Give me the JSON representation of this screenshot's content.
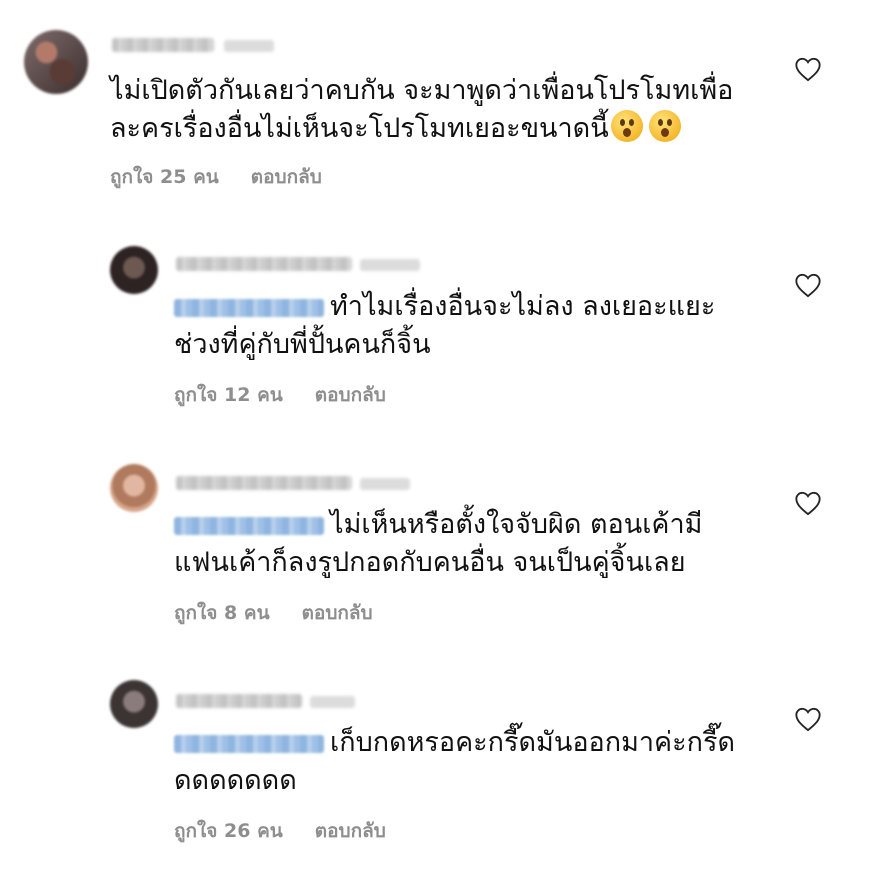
{
  "comments": [
    {
      "text_line1": "ไม่เปิดตัวกันเลยว่าคบกัน จะมาพูดว่าเพื่อนโปรโมทเพื่อ",
      "text_line2": "ละครเรื่องอื่นไม่เห็นจะโปรโมทเยอะขนาดนี้",
      "emojis": [
        "hushed-face-emoji",
        "hushed-face-emoji"
      ],
      "likes": "ถูกใจ 25 คน",
      "reply": "ตอบกลับ"
    },
    {
      "text_line1": "ทำไมเรื่องอื่นจะไม่ลง ลงเยอะแยะ",
      "text_line2": "ช่วงที่คู่กับพี่ปั้นคนก็จิ้น",
      "likes": "ถูกใจ 12 คน",
      "reply": "ตอบกลับ"
    },
    {
      "text_line1": "ไม่เห็นหรือตั้งใจจับผิด ตอนเค้ามี",
      "text_line2": "แฟนเค้าก็ลงรูปกอดกับคนอื่น จนเป็นคู่จิ้นเลย",
      "likes": "ถูกใจ 8 คน",
      "reply": "ตอบกลับ"
    },
    {
      "text_line1": "เก็บกดหรอคะกรี๊ดมันออกมาค่ะกรี๊ด",
      "text_line2": "ดดดดดดด",
      "likes": "ถูกใจ 26 คน",
      "reply": "ตอบกลับ"
    }
  ],
  "colors": {
    "text": "#111111",
    "meta": "#8e8e8e",
    "mention": "#8fb5e0",
    "background": "#ffffff"
  }
}
